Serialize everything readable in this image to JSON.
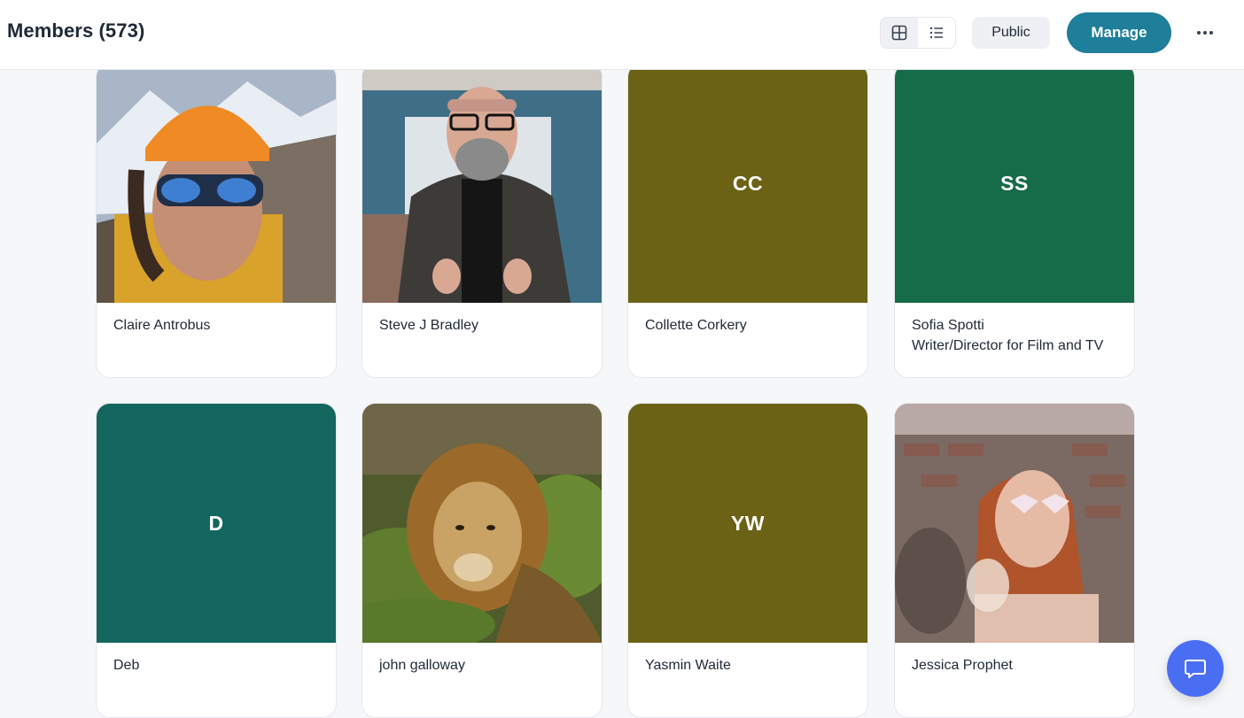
{
  "header": {
    "title": "Members (573)",
    "view_toggle": {
      "grid_icon": "grid-icon",
      "list_icon": "list-icon",
      "active": "grid"
    },
    "public_label": "Public",
    "manage_label": "Manage",
    "more_icon": "more-horizontal-icon"
  },
  "colors": {
    "accent": "#1f7e99",
    "chat": "#4a6ef2",
    "olive": "#6b6216",
    "green": "#166b48",
    "teal": "#14675f"
  },
  "members": [
    {
      "name": "Claire Antrobus",
      "subtitle": "",
      "avatar": "photo",
      "initials": ""
    },
    {
      "name": "Steve J Bradley",
      "subtitle": "",
      "avatar": "photo",
      "initials": ""
    },
    {
      "name": "Collette Corkery",
      "subtitle": "",
      "avatar": "initials",
      "initials": "CC"
    },
    {
      "name": "Sofia Spotti",
      "subtitle": "Writer/Director for Film and TV",
      "avatar": "initials",
      "initials": "SS"
    },
    {
      "name": "Deb",
      "subtitle": "",
      "avatar": "initials",
      "initials": "D"
    },
    {
      "name": "john galloway",
      "subtitle": "",
      "avatar": "photo",
      "initials": ""
    },
    {
      "name": "Yasmin Waite",
      "subtitle": "",
      "avatar": "initials",
      "initials": "YW"
    },
    {
      "name": "Jessica Prophet",
      "subtitle": "",
      "avatar": "photo",
      "initials": ""
    }
  ],
  "chat": {
    "icon": "chat-bubble-icon"
  }
}
